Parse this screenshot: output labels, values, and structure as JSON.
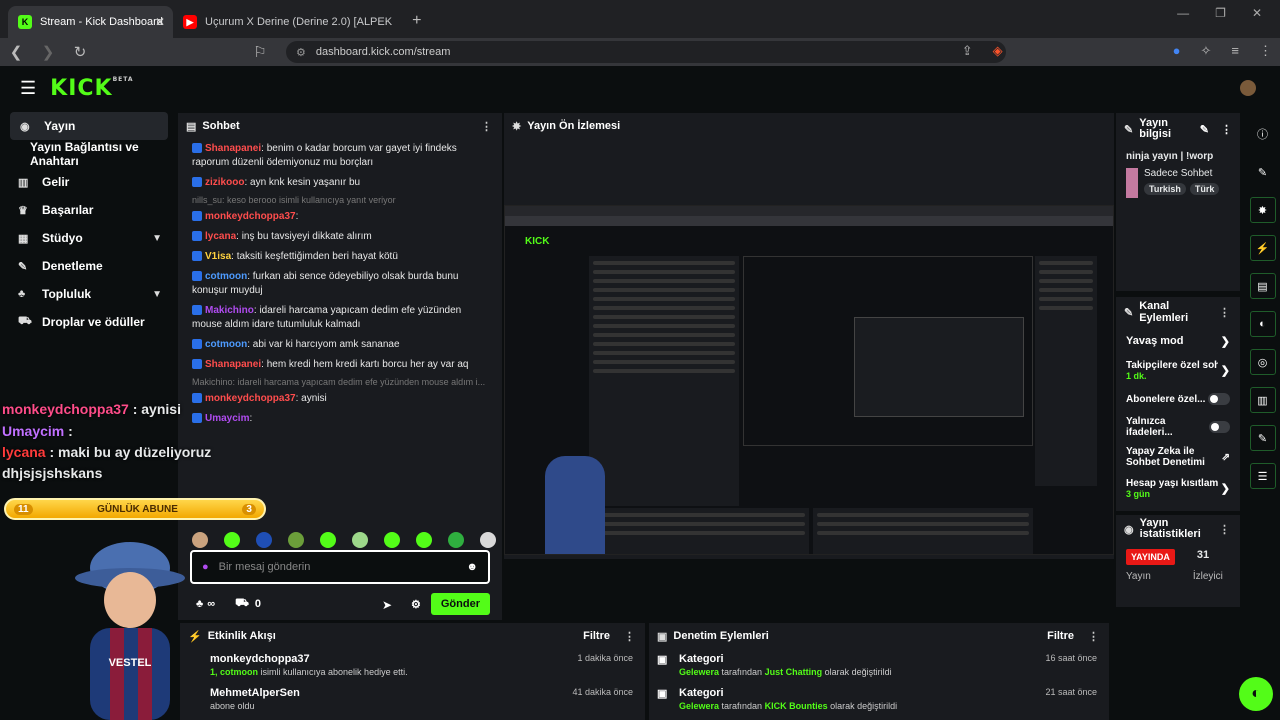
{
  "browser": {
    "tabs": [
      {
        "label": "Stream - Kick Dashboard",
        "active": true
      },
      {
        "label": "Uçurum X Derine (Derine 2.0) [ALPEK",
        "active": false
      }
    ],
    "url": "dashboard.kick.com/stream"
  },
  "header": {
    "logo": "KICK",
    "beta": "BETA"
  },
  "sidebar": {
    "items": [
      {
        "label": "Yayın",
        "icon": "broadcast-icon"
      },
      {
        "label": "Yayın Bağlantısı ve Anahtarı",
        "icon": ""
      },
      {
        "label": "Gelir",
        "icon": "chart-icon"
      },
      {
        "label": "Başarılar",
        "icon": "trophy-icon"
      },
      {
        "label": "Stüdyo",
        "icon": "studio-icon"
      },
      {
        "label": "Denetleme",
        "icon": "wrench-icon"
      },
      {
        "label": "Topluluk",
        "icon": "community-icon"
      },
      {
        "label": "Droplar ve ödüller",
        "icon": "gift-icon"
      }
    ]
  },
  "chat": {
    "title": "Sohbet",
    "messages": [
      {
        "user": "Shanapanei",
        "color": "#ff4d4d",
        "text": ": benim o kadar borcum var gayet iyi findeks raporum düzenli ödemiyonuz mu borçları"
      },
      {
        "user": "zizikooo",
        "color": "#ff4d4d",
        "text": ": ayn knk kesin yaşanır bu"
      },
      {
        "sys": "nills_su: keso berooo isimli kullanıcıya yanıt veriyor"
      },
      {
        "user": "monkeydchoppa37",
        "color": "#ff4d4d",
        "text": ":"
      },
      {
        "user": "lycana",
        "color": "#ff4d4d",
        "text": ": inş bu tavsiyeyi dikkate alırım"
      },
      {
        "user": "V1isa",
        "color": "#ffd23f",
        "text": ": taksiti keşfettiğimden beri hayat kötü"
      },
      {
        "user": "cotmoon",
        "color": "#4d9bff",
        "text": ": furkan abi sence ödeyebiliyo olsak burda bunu konuşur muyduj"
      },
      {
        "user": "Makichino",
        "color": "#b04cf0",
        "text": ": idareli harcama yapıcam dedim efe yüzünden mouse aldım idare tutumluluk kalmadı"
      },
      {
        "user": "cotmoon",
        "color": "#4d9bff",
        "text": ": abi var ki harcıyom amk sananae"
      },
      {
        "user": "Shanapanei",
        "color": "#ff4d4d",
        "text": ": hem kredi hem kredi kartı borcu her ay var aq"
      },
      {
        "sys": "Makichino: idareli harcama yapıcam dedim efe yüzünden mouse aldım i..."
      },
      {
        "user": "monkeydchoppa37",
        "color": "#ff4d4d",
        "text": ": aynisi"
      },
      {
        "user": "Umaycim",
        "color": "#b04cf0",
        "text": ":"
      },
      {
        "sys": "Makichino: idareli harcama yapıcam dedim efe yüzünden mouse aldım i..."
      },
      {
        "user": "lycana",
        "color": "#ff4d4d",
        "text": ": maki bu ay düzeliyoruz dhjsjsjshskans"
      }
    ],
    "placeholder": "Bir mesaj gönderin",
    "points": "∞",
    "gift_count": "0",
    "send_label": "Gönder"
  },
  "preview": {
    "title": "Yayın Ön İzlemesi"
  },
  "overlay": {
    "lines": [
      {
        "user": "monkeydchoppa37",
        "color": "#ff4d8a",
        "text": " : aynisi"
      },
      {
        "user": "Umaycim",
        "color": "#c070ff",
        "text": " :"
      },
      {
        "user": "lycana",
        "color": "#ff3b3b",
        "text": " : maki bu ay düzeliyoruz dhjsjsjshskans"
      }
    ],
    "goal_left": "11",
    "goal_label": "GÜNLÜK ABUNE",
    "goal_right": "3",
    "goal_progress": 0.8
  },
  "stream_info": {
    "title": "Yayın bilgisi",
    "stream_title": "ninja yayın | !worp",
    "category": "Sadece Sohbet",
    "tags": [
      "Turkish",
      "Türk"
    ]
  },
  "channel_actions": {
    "title": "Kanal Eylemleri",
    "items": [
      {
        "label": "Yavaş mod",
        "control": "arrow"
      },
      {
        "label": "Takipçilere özel sohb",
        "sub": "1 dk.",
        "control": "arrow"
      },
      {
        "label": "Abonelere özel...",
        "control": "toggle"
      },
      {
        "label": "Yalnızca ifadeleri...",
        "control": "toggle"
      },
      {
        "label": "Yapay Zeka ile Sohbet Denetimi",
        "control": "external"
      },
      {
        "label": "Hesap yaşı kısıtlamas",
        "sub": "3 gün",
        "control": "arrow"
      }
    ]
  },
  "stats": {
    "title": "Yayın istatistikleri",
    "live_badge": "YAYINDA",
    "viewers": "31",
    "live_label": "Yayın",
    "viewers_label": "İzleyici"
  },
  "activity": {
    "title": "Etkinlik Akışı",
    "filter": "Filtre",
    "rows": [
      {
        "user": "monkeydchoppa37",
        "time": "1 dakika önce",
        "pre": "1, ",
        "highlight": "cotmoon",
        "post": " isimli kullanıcıya abonelik hediye etti."
      },
      {
        "user": "MehmetAlperSen",
        "time": "41 dakika önce",
        "pre": "",
        "highlight": "",
        "post": "abone oldu"
      }
    ]
  },
  "mod_actions": {
    "title": "Denetim Eylemleri",
    "filter": "Filtre",
    "rows": [
      {
        "label": "Kategori",
        "time": "16 saat önce",
        "actor": "Gelewera",
        "mid": " tarafından ",
        "target": "Just Chatting",
        "post": " olarak değiştirildi"
      },
      {
        "label": "Kategori",
        "time": "21 saat önce",
        "actor": "Gelewera",
        "mid": " tarafından ",
        "target": "KICK Bounties",
        "post": " olarak değiştirildi"
      }
    ]
  },
  "colors": {
    "accent": "#53fc18",
    "live": "#e91916"
  }
}
